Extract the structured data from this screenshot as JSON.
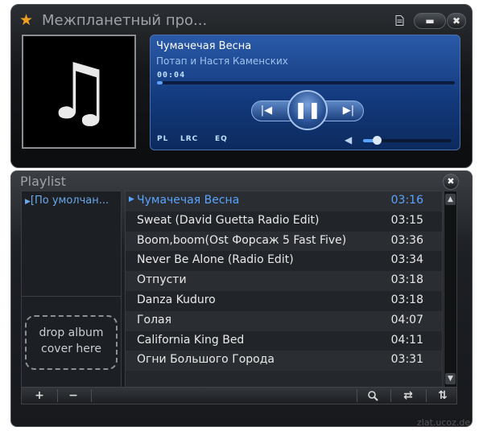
{
  "app": {
    "title": "Межпланетный про...",
    "star_icon": "star-icon",
    "buttons": {
      "notes": "notes-icon",
      "minimize": "minimize-icon",
      "close": "close-icon"
    }
  },
  "now_playing": {
    "title": "Чумачечая Весна",
    "artist": "Потап и Настя Каменских",
    "elapsed": "00:04",
    "progress": 0.02
  },
  "transport": {
    "prev": "previous-icon",
    "pause": "pause-icon",
    "next": "next-icon"
  },
  "mini_tabs": {
    "pl": "PL",
    "lrc": "LRC",
    "eq": "EQ"
  },
  "volume": {
    "level": 0.15,
    "icon": "speaker-icon"
  },
  "playlist": {
    "title": "Playlist",
    "active_list": "[По умолчан...",
    "drop_cover": "drop album cover here",
    "tracks": [
      {
        "name": "Чумачечая Весна",
        "duration": "03:16",
        "current": true
      },
      {
        "name": "Sweat (David Guetta Radio Edit)",
        "duration": "03:15"
      },
      {
        "name": "Boom,boom(Ost Форсаж 5 Fast Five)",
        "duration": "03:36"
      },
      {
        "name": "Never Be Alone (Radio Edit)",
        "duration": "03:34"
      },
      {
        "name": "Отпусти",
        "duration": "03:18"
      },
      {
        "name": "Danza Kuduro",
        "duration": "03:18"
      },
      {
        "name": "Голая",
        "duration": "04:07"
      },
      {
        "name": "California King Bed",
        "duration": "04:11"
      },
      {
        "name": "Огни Большого Города",
        "duration": "03:31"
      }
    ],
    "toolbar": {
      "add": "+",
      "remove": "−",
      "search": "search-icon",
      "repeat": "repeat-icon",
      "sort": "sort-icon"
    }
  },
  "watermark": "zlat.ucoz.de",
  "colors": {
    "accent": "#5aa4ff",
    "screen": "#1b4a93",
    "window": "#1a1c1f"
  }
}
